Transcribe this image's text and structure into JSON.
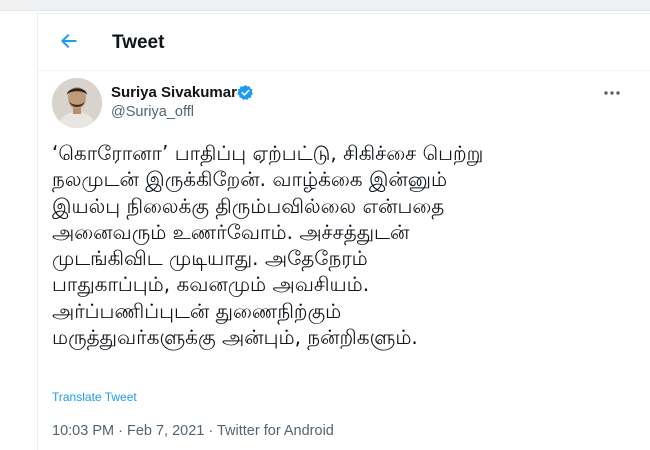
{
  "header": {
    "title": "Tweet",
    "back_icon": "arrow-left-icon"
  },
  "author": {
    "name": "Suriya Sivakumar",
    "handle": "@Suriya_offl",
    "verified_icon": "verified-badge-icon",
    "avatar_icon": "profile-photo"
  },
  "more_icon": "more-horizontal-icon",
  "tweet": {
    "lines": [
      "‘கொரோனா’  பாதிப்பு ஏற்பட்டு, சிகிச்சை பெற்று",
      "நலமுடன் இருக்கிறேன். வாழ்க்கை இன்னும்",
      "இயல்பு நிலைக்கு திரும்பவில்லை என்பதை",
      "அனைவரும்  உணர்வோம். அச்சத்துடன்",
      "முடங்கிவிட முடியாது. அதேநேரம்",
      "பாதுகாப்பும், கவனமும் அவசியம்.",
      "அர்ப்பணிப்புடன் துணைநிற்கும்",
      "மருத்துவர்களுக்கு அன்பும், நன்றிகளும்."
    ],
    "translate_label": "Translate Tweet"
  },
  "meta": {
    "time": "10:03 PM",
    "separator": " · ",
    "date": "Feb 7, 2021",
    "source": "Twitter for Android"
  },
  "colors": {
    "accent": "#1d9bf0",
    "text": "#0f1419",
    "secondary": "#536471"
  }
}
